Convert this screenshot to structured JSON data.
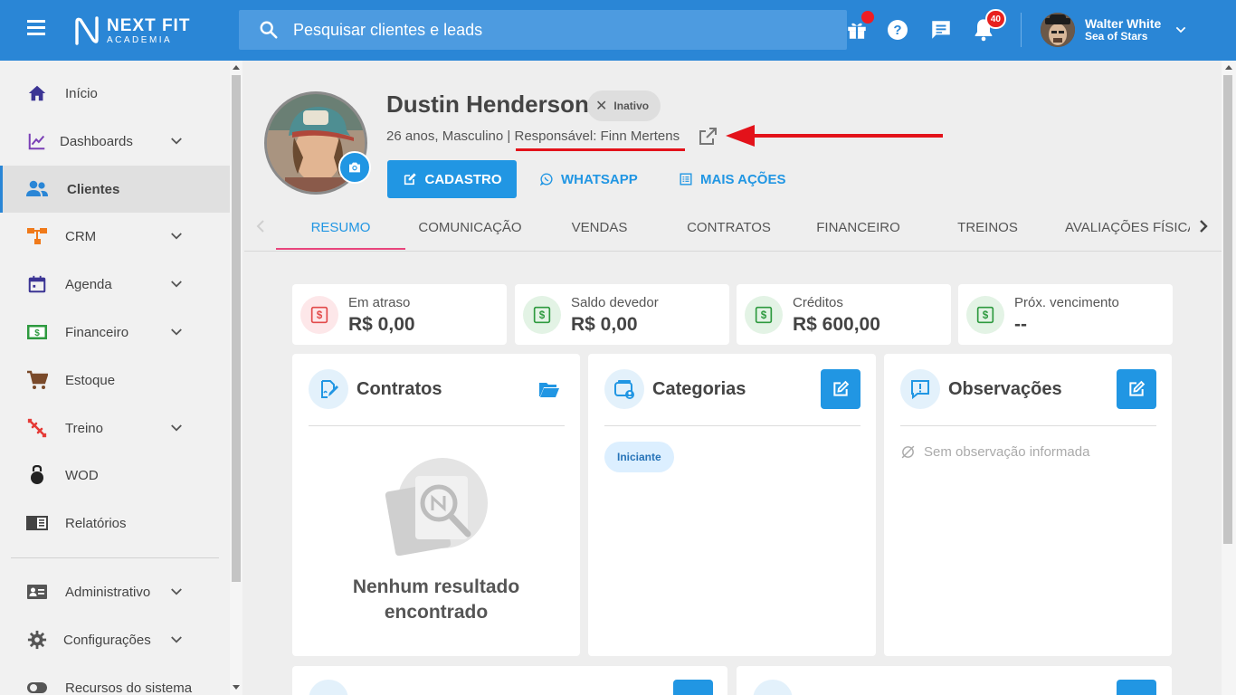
{
  "header": {
    "logo_line1": "NEXT FIT",
    "logo_line2": "ACADEMIA",
    "search_placeholder": "Pesquisar clientes e leads",
    "notifications_count": "40",
    "user_name": "Walter White",
    "user_org": "Sea of Stars",
    "accent_color": "#2a86d6"
  },
  "sidebar": {
    "items": [
      {
        "label": "Início",
        "icon": "home-icon",
        "color": "#3b3494"
      },
      {
        "label": "Dashboards",
        "icon": "chart-line-icon",
        "color": "#7a3fb6",
        "expandable": true
      },
      {
        "label": "Clientes",
        "icon": "people-icon",
        "color": "#2a86d6",
        "active": true
      },
      {
        "label": "CRM",
        "icon": "crm-flow-icon",
        "color": "#f07a1a",
        "expandable": true
      },
      {
        "label": "Agenda",
        "icon": "calendar-icon",
        "color": "#3b3494",
        "expandable": true
      },
      {
        "label": "Financeiro",
        "icon": "money-icon",
        "color": "#2e9a3f",
        "expandable": true
      },
      {
        "label": "Estoque",
        "icon": "cart-icon",
        "color": "#7a4a2a"
      },
      {
        "label": "Treino",
        "icon": "dumbbell-icon",
        "color": "#e53935",
        "expandable": true
      },
      {
        "label": "WOD",
        "icon": "kettlebell-icon",
        "color": "#222222"
      },
      {
        "label": "Relatórios",
        "icon": "report-icon",
        "color": "#444444"
      },
      {
        "label": "Administrativo",
        "icon": "id-card-icon",
        "color": "#555555",
        "expandable": true
      },
      {
        "label": "Configurações",
        "icon": "gear-icon",
        "color": "#555555",
        "expandable": true
      },
      {
        "label": "Recursos do sistema",
        "icon": "toggle-icon",
        "color": "#555555"
      }
    ]
  },
  "profile": {
    "name": "Dustin Henderson",
    "status": "Inativo",
    "meta_prefix": "26 anos, Masculino | ",
    "responsible": "Responsável: Finn Mertens",
    "btn_cadastro": "CADASTRO",
    "btn_whatsapp": "WHATSAPP",
    "btn_more": "MAIS AÇÕES"
  },
  "tabs": [
    "RESUMO",
    "COMUNICAÇÃO",
    "VENDAS",
    "CONTRATOS",
    "FINANCEIRO",
    "TREINOS",
    "AVALIAÇÕES FÍSICA"
  ],
  "active_tab": "RESUMO",
  "summary": [
    {
      "title": "Em atraso",
      "value": "R$ 0,00",
      "tone": "red"
    },
    {
      "title": "Saldo devedor",
      "value": "R$ 0,00",
      "tone": "green"
    },
    {
      "title": "Créditos",
      "value": "R$ 600,00",
      "tone": "green"
    },
    {
      "title": "Próx. vencimento",
      "value": "--",
      "tone": "green"
    }
  ],
  "panels": {
    "contratos": {
      "title": "Contratos",
      "empty_line1": "Nenhum resultado",
      "empty_line2": "encontrado"
    },
    "categorias": {
      "title": "Categorias",
      "chip": "Iniciante"
    },
    "observacoes": {
      "title": "Observações",
      "empty": "Sem observação informada"
    }
  }
}
